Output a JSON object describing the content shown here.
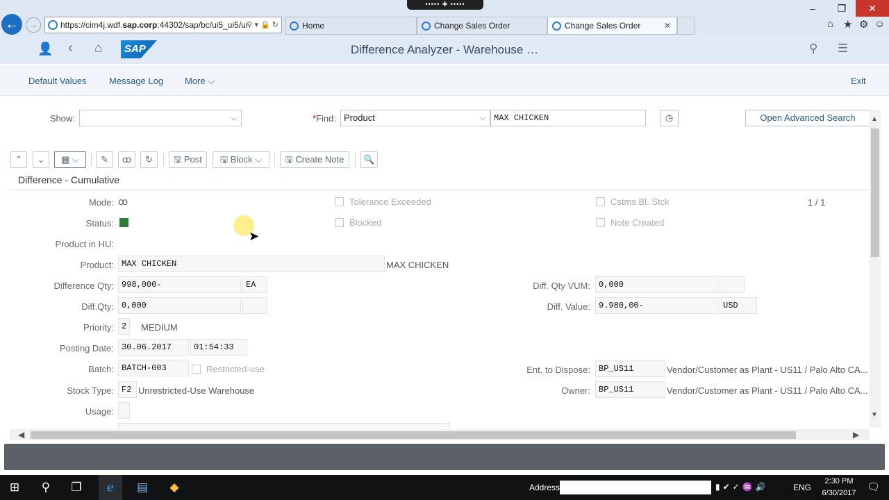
{
  "browser": {
    "url_prefix": "https://cim4j.wdf.",
    "url_bold": "sap.corp",
    "url_suffix": ":44302/sap/bc/ui5_ui5/ui",
    "tabs": [
      {
        "label": "Home"
      },
      {
        "label": "Change Sales Order"
      },
      {
        "label": "Change Sales Order"
      }
    ],
    "screen_toolbar": "••••• ✚ •••••"
  },
  "shell": {
    "logo": "SAP",
    "title": "Difference Analyzer - Warehouse …"
  },
  "app_toolbar": {
    "default_values": "Default Values",
    "message_log": "Message Log",
    "more": "More",
    "exit": "Exit"
  },
  "filter": {
    "show_label": "Show:",
    "show_value": "",
    "find_required": "*",
    "find_label": "Find:",
    "find_type": "Product",
    "find_value": "MAX CHICKEN",
    "advanced_search": "Open Advanced Search"
  },
  "toolbar": {
    "post": "Post",
    "block": "Block",
    "create_note": "Create Note"
  },
  "section": {
    "title": "Difference - Cumulative",
    "pager": "1 / 1"
  },
  "form": {
    "mode_label": "Mode:",
    "status_label": "Status:",
    "status_color": "#2e7d32",
    "product_in_hu_label": "Product in HU:",
    "product_label": "Product:",
    "product_value": "MAX CHICKEN",
    "product_desc": "MAX CHICKEN",
    "diff_qty_label": "Difference Qty:",
    "diff_qty_value": "998,000-",
    "diff_qty_unit": "EA",
    "diff_qty2_label": "Diff.Qty:",
    "diff_qty2_value": "0,000",
    "diff_qty2_unit": "",
    "priority_label": "Priority:",
    "priority_value": "2",
    "priority_text": "MEDIUM",
    "posting_date_label": "Posting Date:",
    "posting_date": "30.06.2017",
    "posting_time": "01:54:33",
    "batch_label": "Batch:",
    "batch_value": "BATCH-003",
    "restricted_label": "Restricted-use",
    "stock_type_label": "Stock Type:",
    "stock_type_value": "F2",
    "stock_type_text": "Unrestricted-Use Warehouse",
    "usage_label": "Usage:",
    "usage_value": "",
    "tolerance_label": "Tolerance Exceeded",
    "blocked_label": "Blocked",
    "cstms_label": "Cstms Bl. Stck",
    "note_created_label": "Note Created",
    "diff_qty_vum_label": "Diff. Qty VUM:",
    "diff_qty_vum_value": "0,000",
    "diff_qty_vum_unit": "",
    "diff_value_label": "Diff. Value:",
    "diff_value": "9.980,00-",
    "diff_value_currency": "USD",
    "ent_dispose_label": "Ent. to Dispose:",
    "ent_dispose_value": "BP_US11",
    "ent_dispose_text": "Vendor/Customer as Plant - US11 / Palo Alto CA...",
    "owner_label": "Owner:",
    "owner_value": "BP_US11",
    "owner_text": "Vendor/Customer as Plant - US11 / Palo Alto CA..."
  },
  "taskbar": {
    "address_label": "Address",
    "lang": "ENG",
    "time": "2:30 PM",
    "date": "6/30/2017"
  }
}
